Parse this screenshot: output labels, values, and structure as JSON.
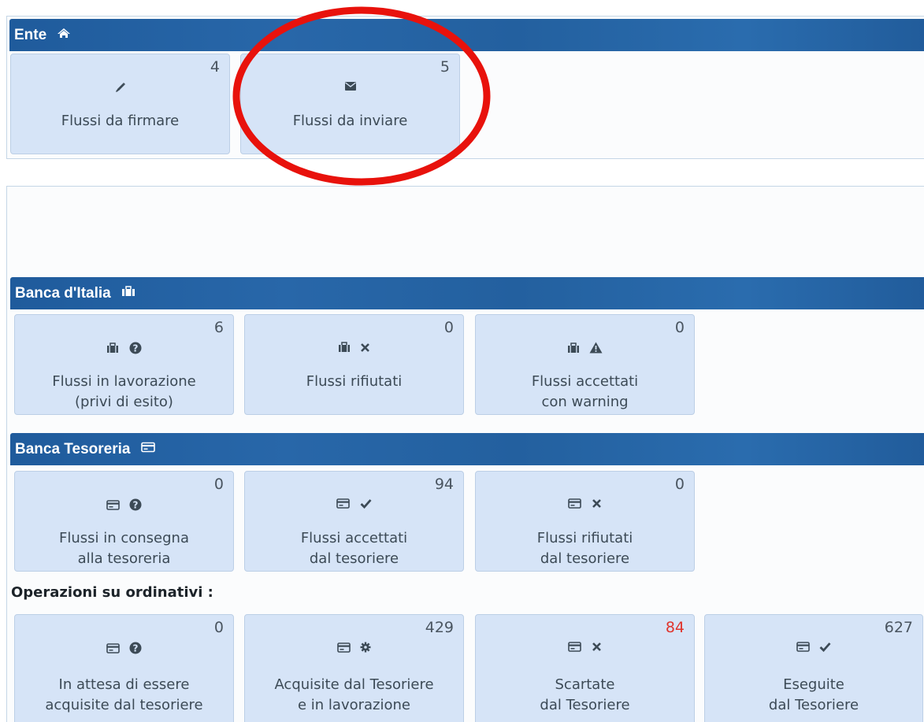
{
  "ente": {
    "title": "Ente",
    "icon": "home-icon",
    "tiles": [
      {
        "count": "4",
        "icons": [
          "pencil-icon"
        ],
        "label": "Flussi da firmare"
      },
      {
        "count": "5",
        "icons": [
          "envelope-icon"
        ],
        "label": "Flussi da inviare"
      }
    ]
  },
  "banca_italia": {
    "title": "Banca d'Italia",
    "icon": "institution-icon",
    "tiles": [
      {
        "count": "6",
        "icons": [
          "institution-icon",
          "question-circle-icon"
        ],
        "label": "Flussi in lavorazione\n(privi di esito)"
      },
      {
        "count": "0",
        "icons": [
          "institution-icon",
          "times-icon"
        ],
        "label": "Flussi rifiutati"
      },
      {
        "count": "0",
        "icons": [
          "institution-icon",
          "warning-icon"
        ],
        "label": "Flussi accettati\ncon warning"
      }
    ]
  },
  "banca_tesoreria": {
    "title": "Banca Tesoreria",
    "icon": "credit-card-icon",
    "tiles": [
      {
        "count": "0",
        "icons": [
          "credit-card-icon",
          "question-circle-icon"
        ],
        "label": "Flussi in consegna\nalla tesoreria"
      },
      {
        "count": "94",
        "icons": [
          "credit-card-icon",
          "check-icon"
        ],
        "label": "Flussi accettati\ndal tesoriere"
      },
      {
        "count": "0",
        "icons": [
          "credit-card-icon",
          "times-icon"
        ],
        "label": "Flussi rifiutati\ndal tesoriere"
      }
    ]
  },
  "operazioni": {
    "title": "Operazioni su ordinativi :",
    "tiles": [
      {
        "count": "0",
        "icons": [
          "credit-card-icon",
          "question-circle-icon"
        ],
        "label": "In attesa di essere\nacquisite dal tesoriere"
      },
      {
        "count": "429",
        "icons": [
          "credit-card-icon",
          "gear-icon"
        ],
        "label": "Acquisite dal Tesoriere\ne in lavorazione"
      },
      {
        "count": "84",
        "count_color": "#e0342c",
        "icons": [
          "credit-card-icon",
          "times-icon"
        ],
        "label": "Scartate\ndal Tesoriere"
      },
      {
        "count": "627",
        "icons": [
          "credit-card-icon",
          "check-icon"
        ],
        "label": "Eseguite\ndal Tesoriere"
      }
    ]
  },
  "colors": {
    "header": "#2563a3",
    "tile_bg": "#d6e4f7",
    "highlight": "#e8120c",
    "alert": "#e0342c"
  }
}
